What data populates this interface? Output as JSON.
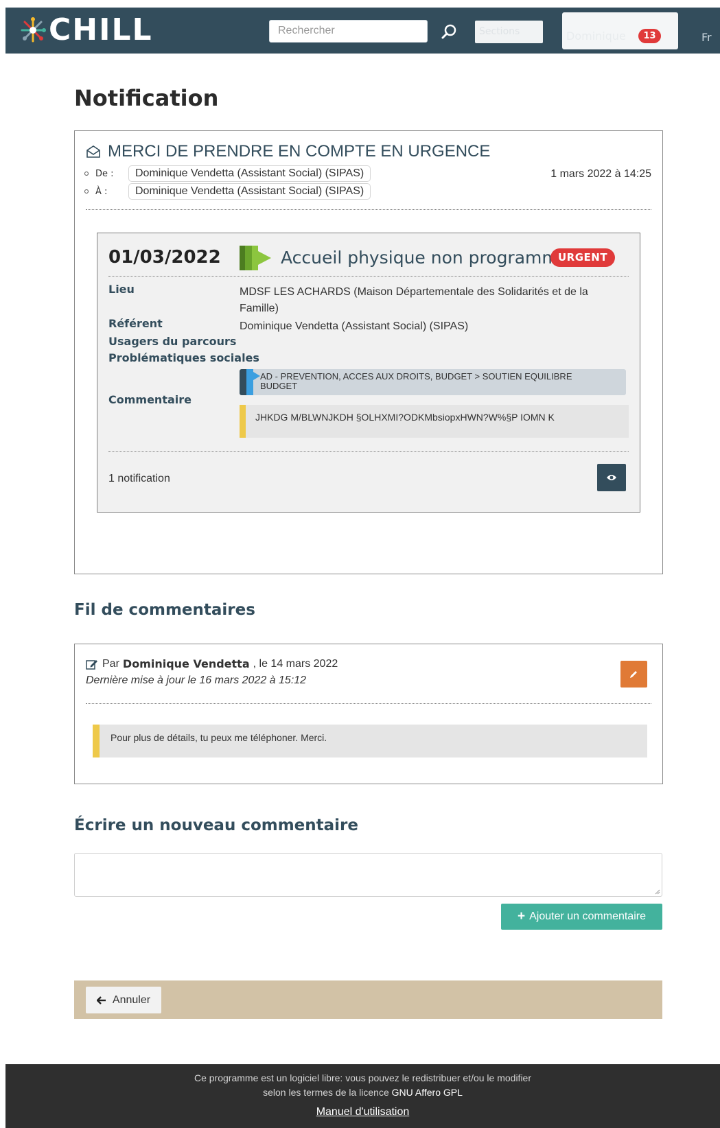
{
  "header": {
    "logo_text": "CHILL",
    "search_placeholder": "Rechercher",
    "nav_button_label": "Sections",
    "user_label": "Dominique",
    "badge_count": "13",
    "lang": "Fr"
  },
  "page": {
    "title": "Notification"
  },
  "notification": {
    "subject": "MERCI DE PRENDRE EN COMPTE EN URGENCE",
    "from_label": "De :",
    "from": "Dominique Vendetta (Assistant Social) (SIPAS)",
    "to_label": "À :",
    "to": "Dominique Vendetta (Assistant Social) (SIPAS)",
    "date": "1 mars 2022 à 14:25"
  },
  "activity": {
    "date": "01/03/2022",
    "type": "Accueil physique non programmé",
    "urgent_label": "URGENT",
    "fields": {
      "lieu_label": "Lieu",
      "lieu_value": "MDSF LES ACHARDS (Maison Départementale des Solidarités et de la Famille)",
      "referent_label": "Référent",
      "referent_value": "Dominique Vendetta (Assistant Social) (SIPAS)",
      "usagers_label": "Usagers du parcours",
      "problematiques_label": "Problématiques sociales",
      "problematiques_value": "AD - PREVENTION, ACCES AUX DROITS, BUDGET > SOUTIEN EQUILIBRE BUDGET",
      "commentaire_label": "Commentaire",
      "commentaire_value": "JHKDG M/BLWNJKDH §OLHXMI?ODKMbsiopxHWN?W%§P IOMN K"
    },
    "notification_count": "1 notification"
  },
  "thread": {
    "heading": "Fil de commentaires",
    "by_prefix": "Par",
    "author": "Dominique Vendetta",
    "by_suffix": ", le 14 mars 2022",
    "updated": "Dernière mise à jour le 16 mars 2022 à 15:12",
    "comment": "Pour plus de détails, tu peux me téléphoner. Merci."
  },
  "new_comment": {
    "heading": "Écrire un nouveau commentaire",
    "add_button": "Ajouter un commentaire"
  },
  "actions": {
    "cancel": "Annuler"
  },
  "footer": {
    "line1": "Ce programme est un logiciel libre: vous pouvez le redistribuer et/ou le modifier",
    "line2_prefix": "selon les termes de la licence",
    "license": "GNU Affero GPL",
    "manual": "Manuel d'utilisation"
  },
  "colors": {
    "header_bg": "#334d5c",
    "urgent": "#e03a3a",
    "add_button": "#43b29d",
    "edit_button": "#e07a36",
    "sticky_bar": "#d2c2a6",
    "comment_accent": "#eec94a"
  }
}
